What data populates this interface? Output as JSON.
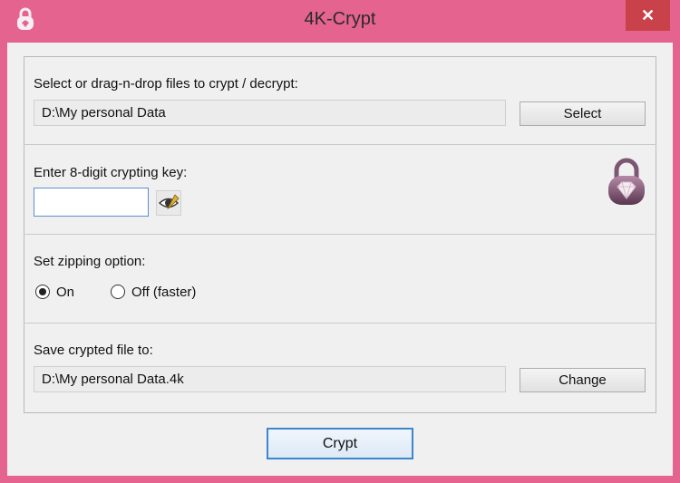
{
  "window": {
    "title": "4K-Crypt",
    "close_label": "✕"
  },
  "select_section": {
    "label": "Select or drag-n-drop files to crypt / decrypt:",
    "path_value": "D:\\My personal Data",
    "button_label": "Select"
  },
  "key_section": {
    "label": "Enter 8-digit crypting key:",
    "key_value": ""
  },
  "zip_section": {
    "label": "Set zipping option:",
    "options": [
      {
        "label": "On",
        "selected": true
      },
      {
        "label": "Off (faster)",
        "selected": false
      }
    ]
  },
  "save_section": {
    "label": "Save crypted file to:",
    "path_value": "D:\\My personal Data.4k",
    "button_label": "Change"
  },
  "footer": {
    "crypt_label": "Crypt"
  },
  "icons": {
    "app": "padlock-icon",
    "show_key": "eye-icon",
    "logo": "diamond-lock-icon"
  },
  "colors": {
    "frame": "#e5648f",
    "close": "#c9424a",
    "accent": "#3c86d0"
  }
}
